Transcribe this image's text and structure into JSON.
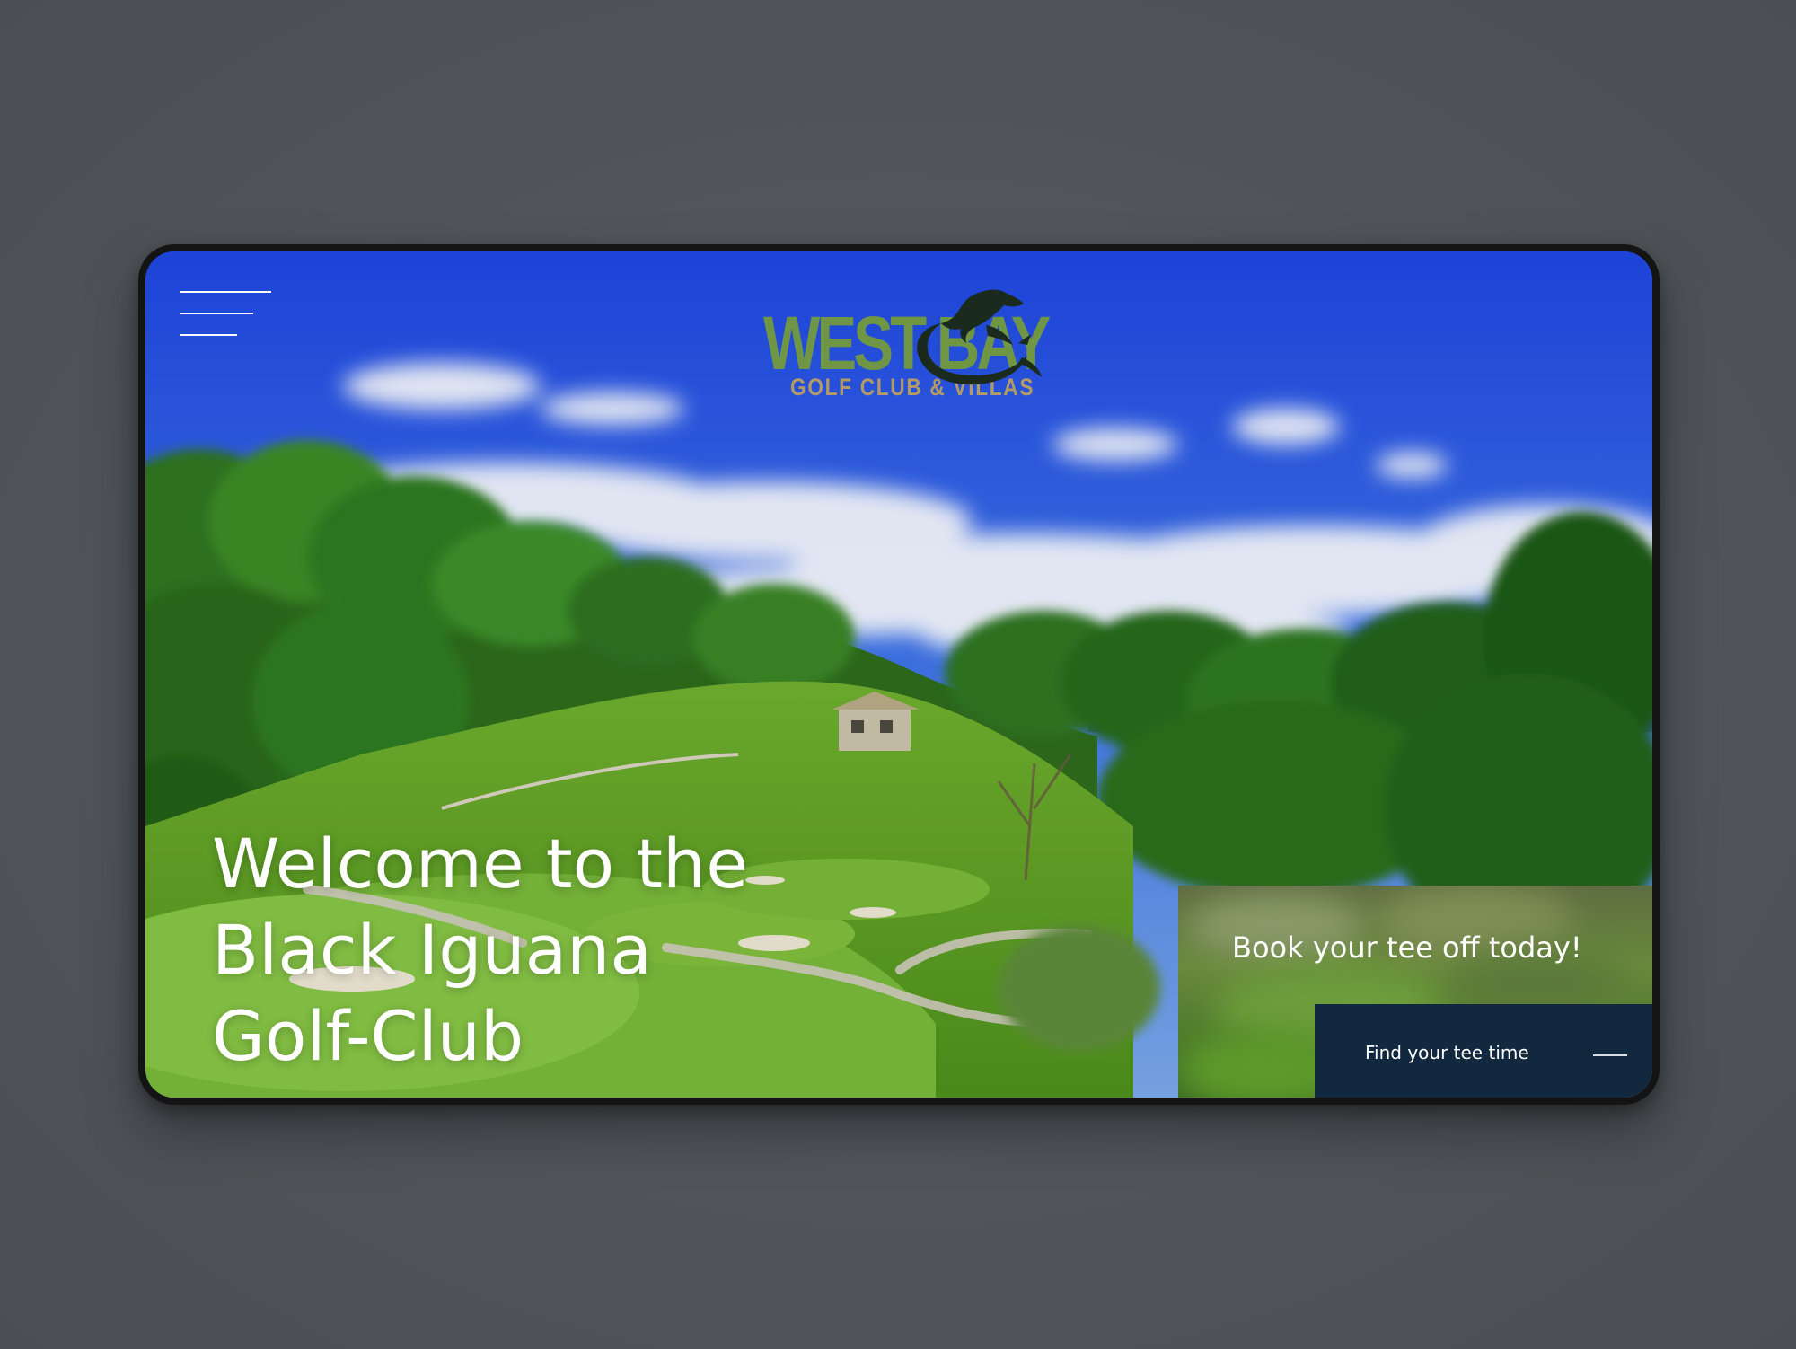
{
  "header": {
    "menu_icon": "hamburger-menu-icon",
    "logo": {
      "word": "WEST BAY",
      "subtitle": "GOLF CLUB & VILLAS",
      "emblem_icon": "iguana-icon",
      "colors": {
        "word": "#6f9645",
        "subtitle": "#b39964",
        "emblem": "#1a2a1c"
      }
    }
  },
  "hero": {
    "title_lines": [
      "Welcome to the",
      "Black Iguana",
      "Golf-Club"
    ]
  },
  "booking": {
    "heading": "Book your tee off today!",
    "button_label": "Find your tee time",
    "button_icon": "dash-arrow-icon",
    "button_color": "#12283f"
  }
}
